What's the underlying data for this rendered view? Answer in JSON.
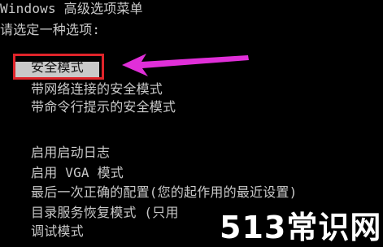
{
  "header": {
    "title": "Windows 高级选项菜单",
    "prompt": "请选定一种选项:"
  },
  "menu": {
    "items": [
      {
        "label": "安全模式",
        "selected": true
      },
      {
        "label": "带网络连接的安全模式"
      },
      {
        "label": "带命令行提示的安全模式"
      },
      {
        "label": "启用启动日志"
      },
      {
        "label": "启用 VGA 模式"
      },
      {
        "label": "最后一次正确的配置(您的起作用的最近设置)"
      },
      {
        "label": "目录服务恢复模式 (只用"
      },
      {
        "label": "调试模式"
      }
    ]
  },
  "annotation": {
    "highlight_color": "#e0242a",
    "arrow_color": "#e02fd8"
  },
  "watermark": {
    "text": "513常识网"
  }
}
